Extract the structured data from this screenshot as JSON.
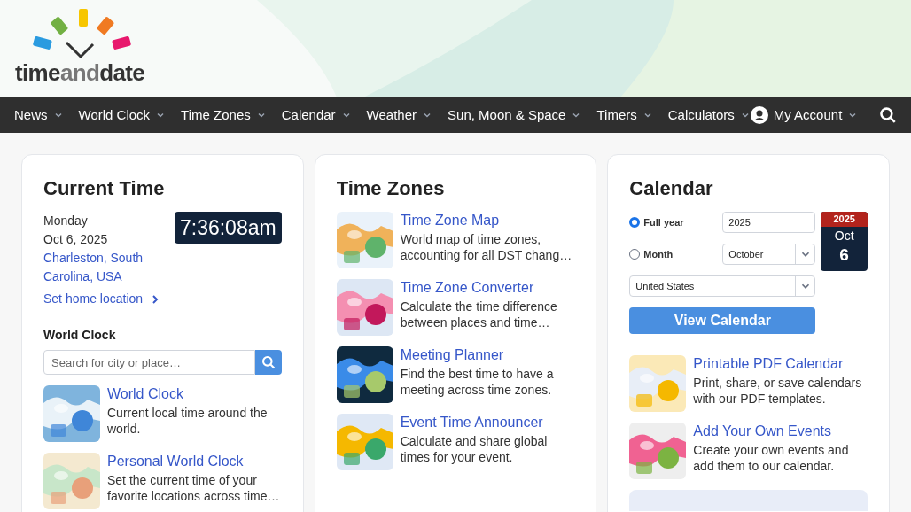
{
  "logo": {
    "parts": [
      "time",
      "and",
      "date"
    ]
  },
  "nav": {
    "items": [
      "News",
      "World Clock",
      "Time Zones",
      "Calendar",
      "Weather",
      "Sun, Moon & Space",
      "Timers",
      "Calculators"
    ],
    "account": "My Account"
  },
  "current_time": {
    "title": "Current Time",
    "day": "Monday",
    "date": "Oct 6, 2025",
    "location": "Charleston, South Carolina, USA",
    "clock": "7:36:08am",
    "home_link": "Set home location",
    "world_clock_label": "World Clock",
    "search_placeholder": "Search for city or place…",
    "links": [
      {
        "title": "World Clock",
        "description": "Current local time around the world."
      },
      {
        "title": "Personal World Clock",
        "description": "Set the current time of your favorite locations across time…"
      }
    ]
  },
  "time_zones": {
    "title": "Time Zones",
    "links": [
      {
        "title": "Time Zone Map",
        "description": "World map of time zones, accounting for all DST chang…"
      },
      {
        "title": "Time Zone Converter",
        "description": "Calculate the time difference between places and time…"
      },
      {
        "title": "Meeting Planner",
        "description": "Find the best time to have a meeting across time zones."
      },
      {
        "title": "Event Time Announcer",
        "description": "Calculate and share global times for your event."
      }
    ]
  },
  "calendar": {
    "title": "Calendar",
    "options": [
      {
        "label": "Full year",
        "selected": true,
        "field": "2025",
        "kind": "input"
      },
      {
        "label": "Month",
        "selected": false,
        "field": "October",
        "kind": "select"
      }
    ],
    "country": "United States",
    "date_badge": {
      "year": "2025",
      "month": "Oct",
      "day": "6"
    },
    "button": "View Calendar",
    "links": [
      {
        "title": "Printable PDF Calendar",
        "description": "Print, share, or save calendars with our PDF templates."
      },
      {
        "title": "Add Your Own Events",
        "description": "Create your own events and add them to our calendar."
      }
    ]
  }
}
